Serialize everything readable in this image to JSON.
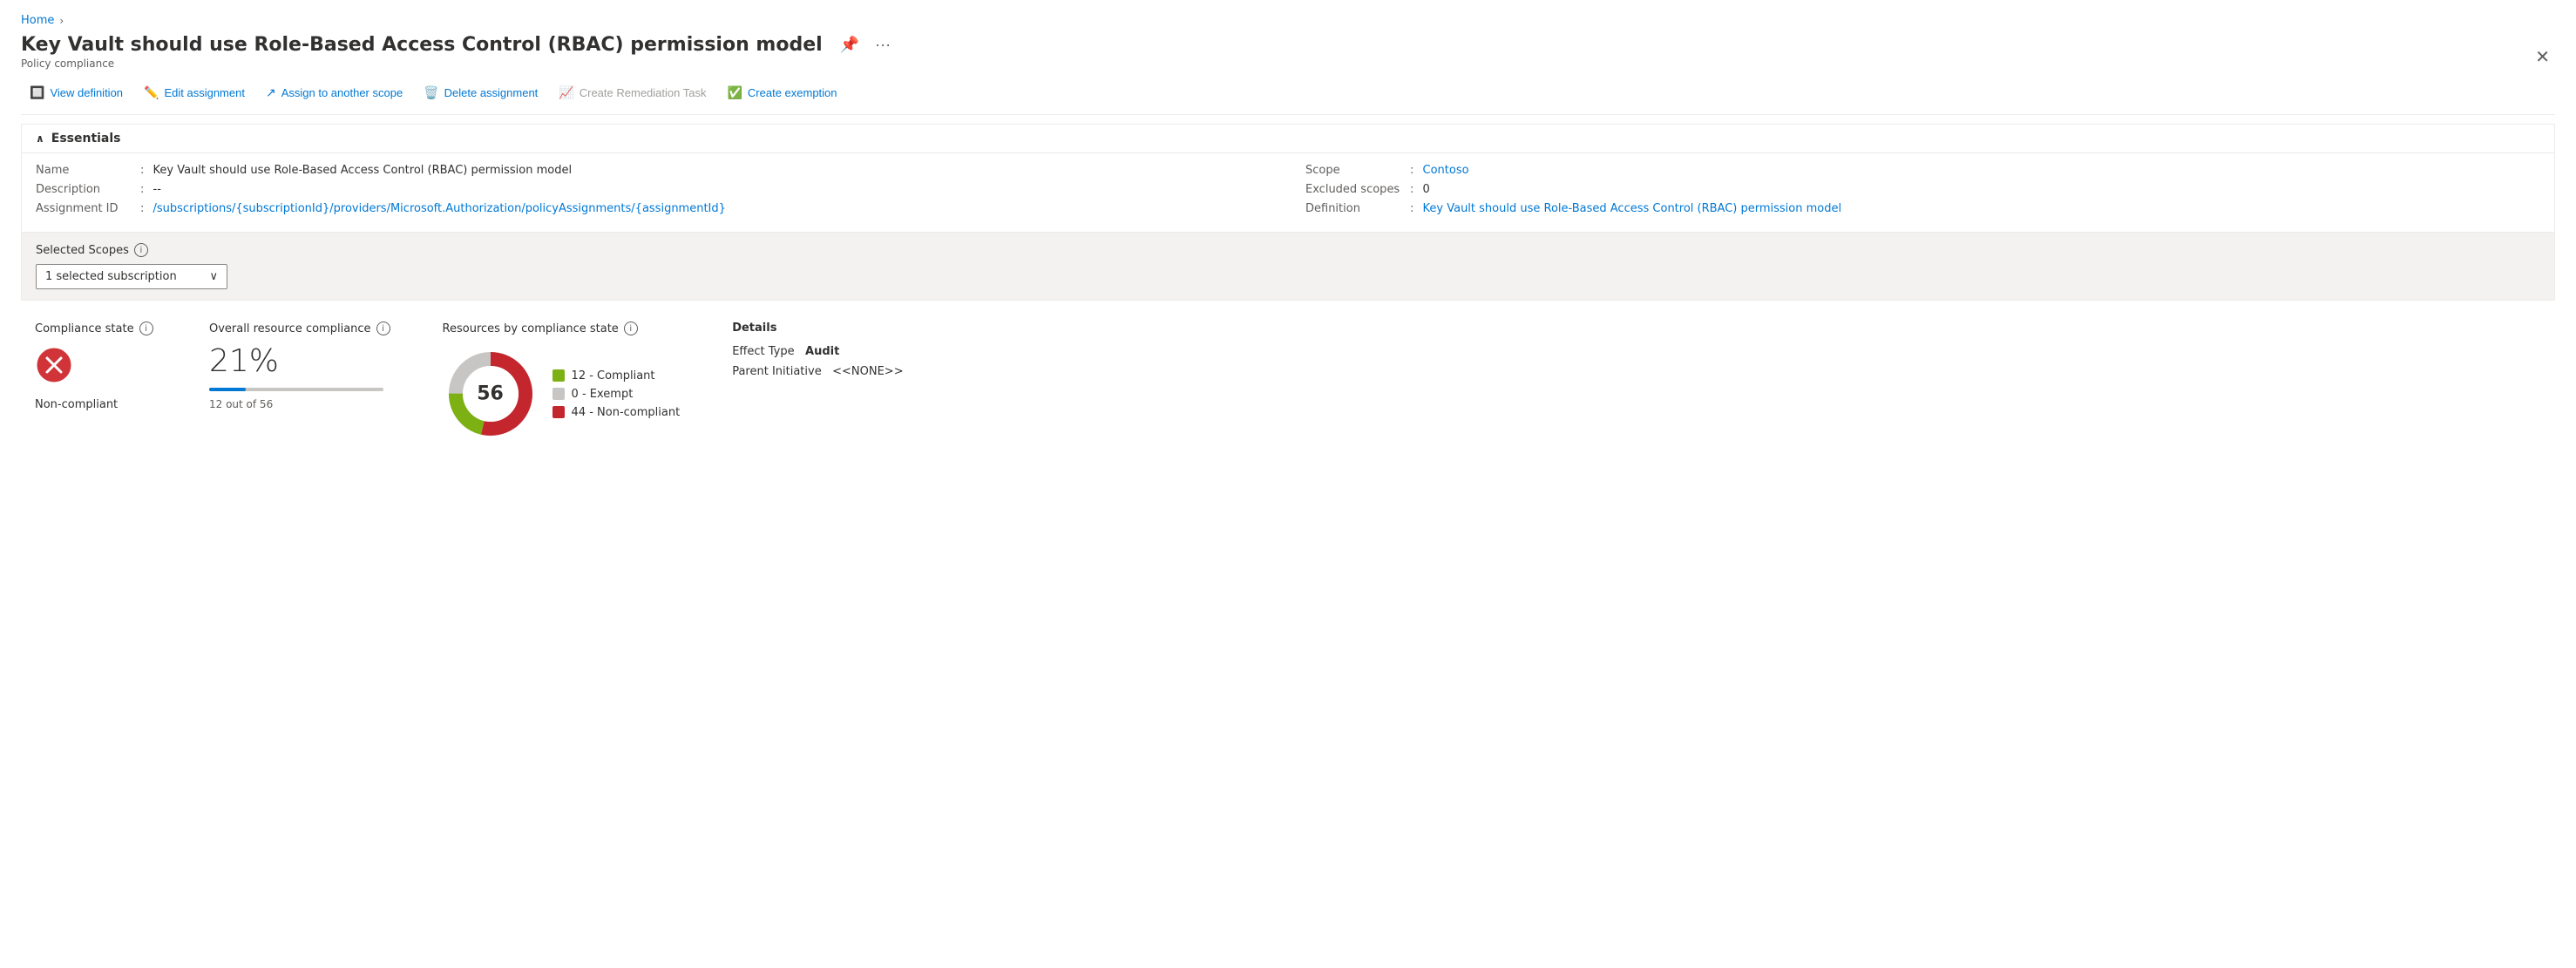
{
  "breadcrumb": {
    "home": "Home",
    "sep": "›"
  },
  "page": {
    "title": "Key Vault should use Role-Based Access Control (RBAC) permission model",
    "subtitle": "Policy compliance"
  },
  "toolbar": {
    "view_definition": "View definition",
    "edit_assignment": "Edit assignment",
    "assign_to_another_scope": "Assign to another scope",
    "delete_assignment": "Delete assignment",
    "create_remediation_task": "Create Remediation Task",
    "create_exemption": "Create exemption"
  },
  "essentials": {
    "header": "Essentials",
    "name_label": "Name",
    "name_value": "Key Vault should use Role-Based Access Control (RBAC) permission model",
    "description_label": "Description",
    "description_value": "--",
    "assignment_id_label": "Assignment ID",
    "assignment_id_value": "/subscriptions/{subscriptionId}/providers/Microsoft.Authorization/policyAssignments/{assignmentId}",
    "scope_label": "Scope",
    "scope_value": "Contoso",
    "excluded_scopes_label": "Excluded scopes",
    "excluded_scopes_value": "0",
    "definition_label": "Definition",
    "definition_value": "Key Vault should use Role-Based Access Control (RBAC) permission model"
  },
  "scopes": {
    "label": "Selected Scopes",
    "dropdown_value": "1 selected subscription"
  },
  "compliance_state": {
    "title": "Compliance state",
    "value": "Non-compliant",
    "icon_color": "#d13438"
  },
  "overall_resource_compliance": {
    "title": "Overall resource compliance",
    "percentage": "21%",
    "detail": "12 out of 56",
    "fill_percent": 21
  },
  "resources_by_compliance": {
    "title": "Resources by compliance state",
    "total": 56,
    "compliant": 12,
    "exempt": 0,
    "non_compliant": 44,
    "legend": [
      {
        "label": "12 - Compliant",
        "color": "#7db012"
      },
      {
        "label": "0 - Exempt",
        "color": "#c8c6c4"
      },
      {
        "label": "44 - Non-compliant",
        "color": "#c4262e"
      }
    ]
  },
  "details": {
    "title": "Details",
    "effect_type_label": "Effect Type",
    "effect_type_value": "Audit",
    "parent_initiative_label": "Parent Initiative",
    "parent_initiative_value": "<<NONE>>"
  }
}
